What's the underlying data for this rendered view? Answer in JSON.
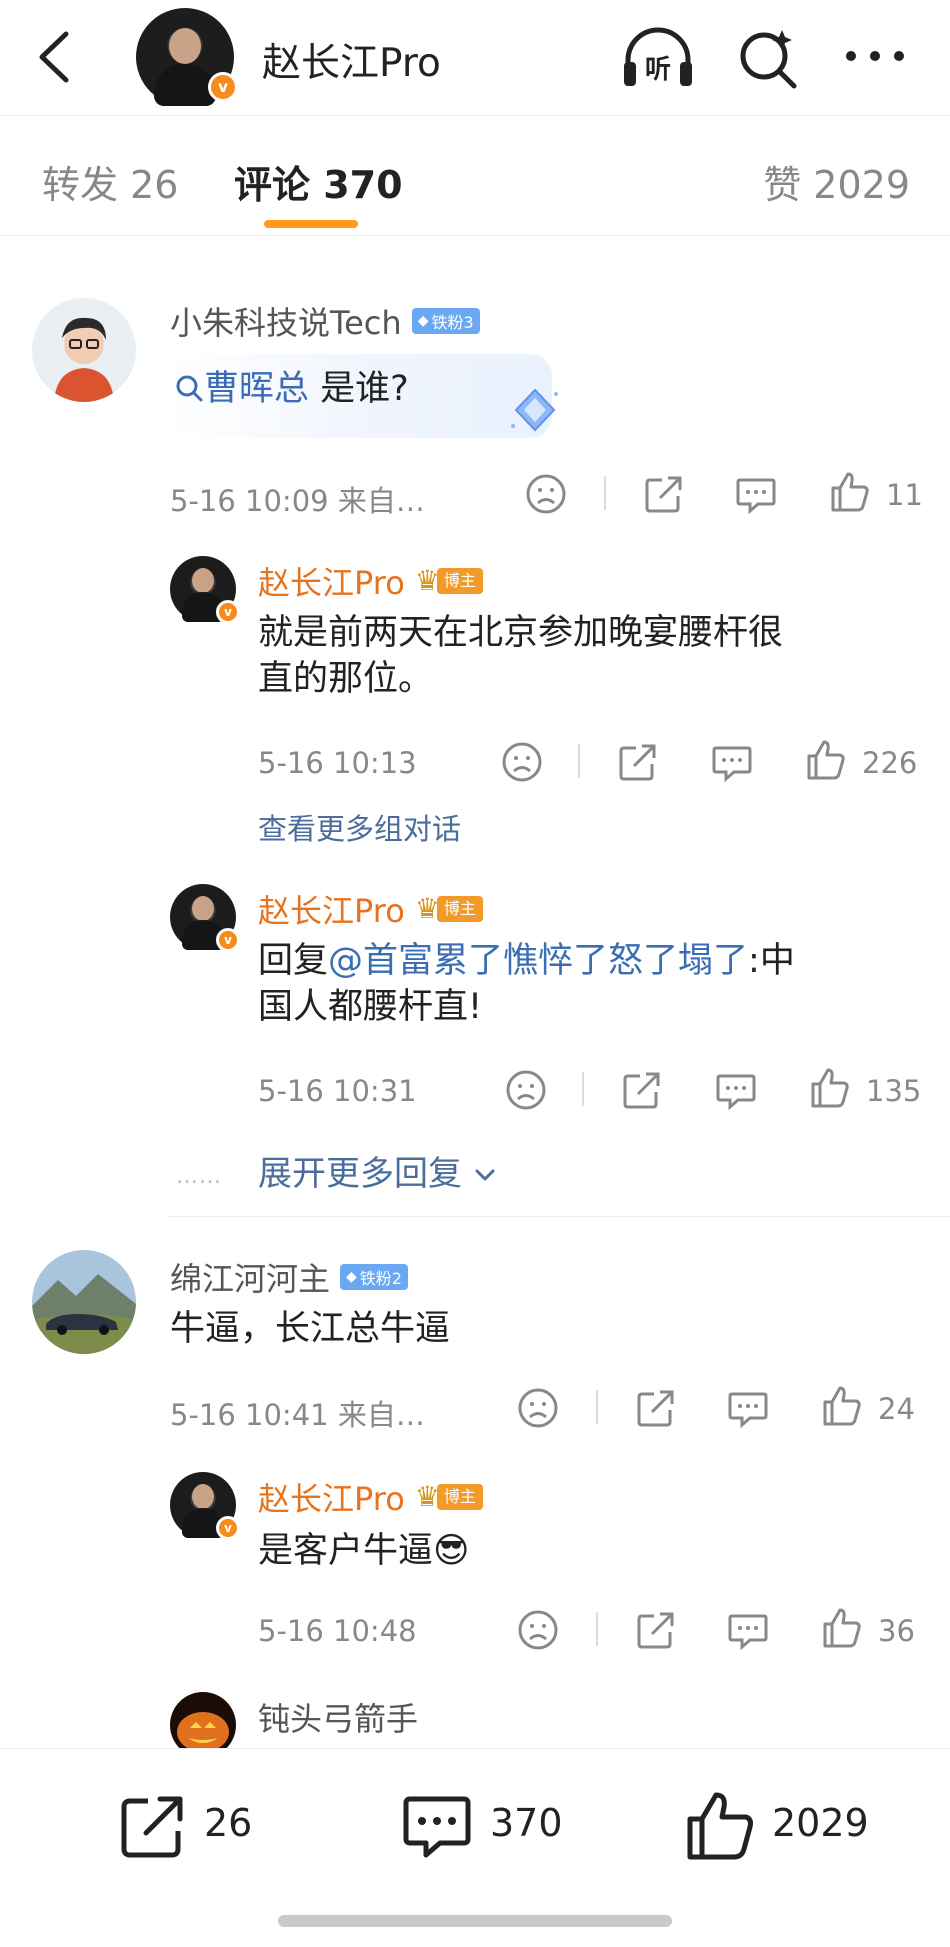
{
  "header": {
    "title": "赵长江Pro",
    "listen_label": "听"
  },
  "tabs": {
    "repost": "转发 26",
    "comments": "评论 370",
    "likes": "赞 2029"
  },
  "comments": [
    {
      "user": "小朱科技说Tech",
      "fan_badge": "铁粉3",
      "search_keyword": "曹晖总",
      "text_rest": " 是谁?",
      "time": "5-16 10:09",
      "source": "来自…",
      "likes": "11",
      "replies": [
        {
          "user": "赵长江Pro",
          "role_badge": "博主",
          "text_line1": "就是前两天在北京参加晚宴腰杆很",
          "text_line2": "直的那位。",
          "time": "5-16 10:13",
          "likes": "226"
        },
        {
          "user": "赵长江Pro",
          "role_badge": "博主",
          "reply_prefix": "回复",
          "mention": "@首富累了憔悴了怒了塌了",
          "text_rest": ":中",
          "text_line2": "国人都腰杆直!",
          "time": "5-16 10:31",
          "likes": "135"
        }
      ],
      "more_conversation": "查看更多组对话",
      "expand_more": "展开更多回复",
      "expand_dots": "……"
    },
    {
      "user": "绵江河河主",
      "fan_badge": "铁粉2",
      "text": "牛逼，长江总牛逼",
      "time": "5-16 10:41",
      "source": "来自…",
      "likes": "24",
      "replies": [
        {
          "user": "赵长江Pro",
          "role_badge": "博主",
          "text": "是客户牛逼😎",
          "time": "5-16 10:48",
          "likes": "36"
        }
      ]
    },
    {
      "user": "钝头弓箭手"
    }
  ],
  "bottom_bar": {
    "repost_count": "26",
    "comment_count": "370",
    "like_count": "2029"
  },
  "colors": {
    "accent_orange": "#ff9a1f",
    "blogger_name": "#e8731f",
    "link_blue": "#3b6db4",
    "fan_badge_blue": "#6aa8f2"
  }
}
